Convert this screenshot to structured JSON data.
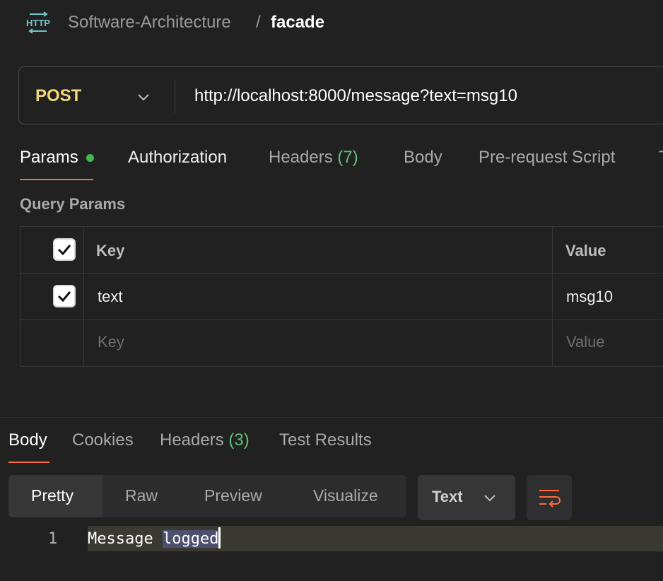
{
  "breadcrumb": {
    "icon": "http-icon",
    "icon_text": "HTTP",
    "collection": "Software-Architecture",
    "separator": "/",
    "request_name": "facade"
  },
  "request": {
    "method": "POST",
    "url": "http://localhost:8000/message?text=msg10"
  },
  "request_tabs": [
    {
      "label": "Params",
      "indicator": "green-dot",
      "active": true
    },
    {
      "label": "Authorization"
    },
    {
      "label": "Headers",
      "count": "(7)"
    },
    {
      "label": "Body"
    },
    {
      "label": "Pre-request Script"
    },
    {
      "label": "T"
    }
  ],
  "query_params": {
    "title": "Query Params",
    "columns": [
      "Key",
      "Value"
    ],
    "rows": [
      {
        "checked": true,
        "key": "text",
        "value": "msg10"
      }
    ],
    "new_row": {
      "key_placeholder": "Key",
      "value_placeholder": "Value"
    }
  },
  "response_tabs": [
    {
      "label": "Body",
      "active": true
    },
    {
      "label": "Cookies"
    },
    {
      "label": "Headers",
      "count": "(3)"
    },
    {
      "label": "Test Results"
    }
  ],
  "view_modes": [
    "Pretty",
    "Raw",
    "Preview",
    "Visualize"
  ],
  "active_view_mode": "Pretty",
  "format": "Text",
  "response_body": {
    "line_number": "1",
    "text_before_selection": "Message ",
    "selected_text": "logged"
  },
  "colors": {
    "accent": "#ff6c37",
    "method": "#f2d778",
    "count_green": "#5cc27a",
    "status_dot": "#3fb950",
    "icon_teal": "#6ec6d0"
  }
}
